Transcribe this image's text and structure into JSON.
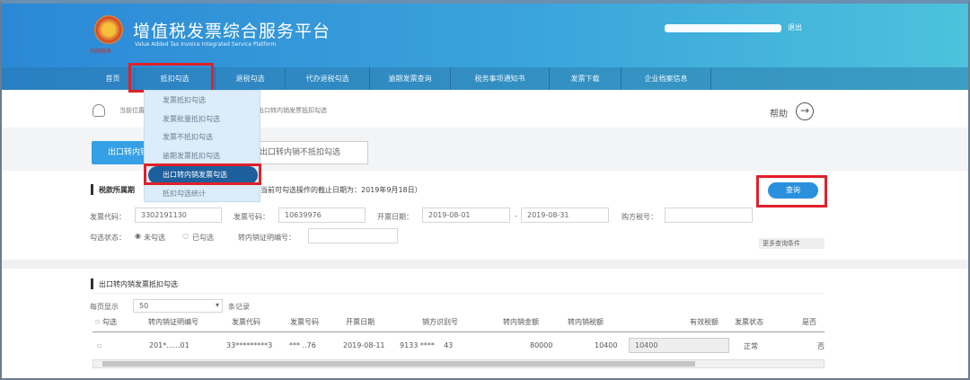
{
  "header": {
    "title": "增值税发票综合服务平台",
    "subtitle": "Value Added Tax Invoice Integrated Service Platform",
    "logo_text": "中国税务",
    "logout": "退出"
  },
  "nav": [
    "首页",
    "抵扣勾选",
    "退税勾选",
    "代办退税勾选",
    "逾期发票查询",
    "税务事项通知书",
    "发票下载",
    "企业档案信息"
  ],
  "dropdown": [
    "发票抵扣勾选",
    "发票批量抵扣勾选",
    "发票不抵扣勾选",
    "逾期发票抵扣勾选",
    "出口转内销发票勾选",
    "抵扣勾选统计"
  ],
  "breadcrumb": {
    "prefix": "当前位置：",
    "current": "出口转内销发票抵扣勾选"
  },
  "help": "帮助",
  "tabs": [
    "出口转内销发票抵扣勾选",
    "出口转内销不抵扣勾选"
  ],
  "section1": {
    "title": "税款所属期",
    "note": "（当前可勾选操作的截止日期为：2019年9月18日）",
    "query_button": "查询"
  },
  "filters": {
    "invoice_code_label": "发票代码：",
    "invoice_code": "3302191130",
    "invoice_no_label": "发票号码：",
    "invoice_no": "10639976",
    "date_label": "开票日期：",
    "date_from": "2019-08-01",
    "date_sep": "-",
    "date_to": "2019-08-31",
    "buyer_tax_label": "购方税号：",
    "buyer_tax": "",
    "status_label": "勾选状态：",
    "status_opt1": "未勾选",
    "status_opt2": "已勾选",
    "cert_label": "转内销证明编号：",
    "cert": "",
    "more": "更多查询条件"
  },
  "section2": {
    "title": "出口转内销发票抵扣勾选",
    "per_page_label": "每页显示",
    "per_page": "50",
    "records_label": "条记录"
  },
  "table": {
    "headers": [
      "勾选",
      "转内销证明编号",
      "发票代码",
      "发票号码",
      "开票日期",
      "销方识别号",
      "转内销金额",
      "转内销税额",
      "有效税额",
      "发票状态",
      "是否"
    ],
    "rows": [
      [
        "",
        "201*......01",
        "33*********3",
        "*** ..76",
        "2019-08-11",
        "9133 ****    43",
        "80000",
        "10400",
        "10400",
        "正常",
        "否"
      ]
    ]
  }
}
